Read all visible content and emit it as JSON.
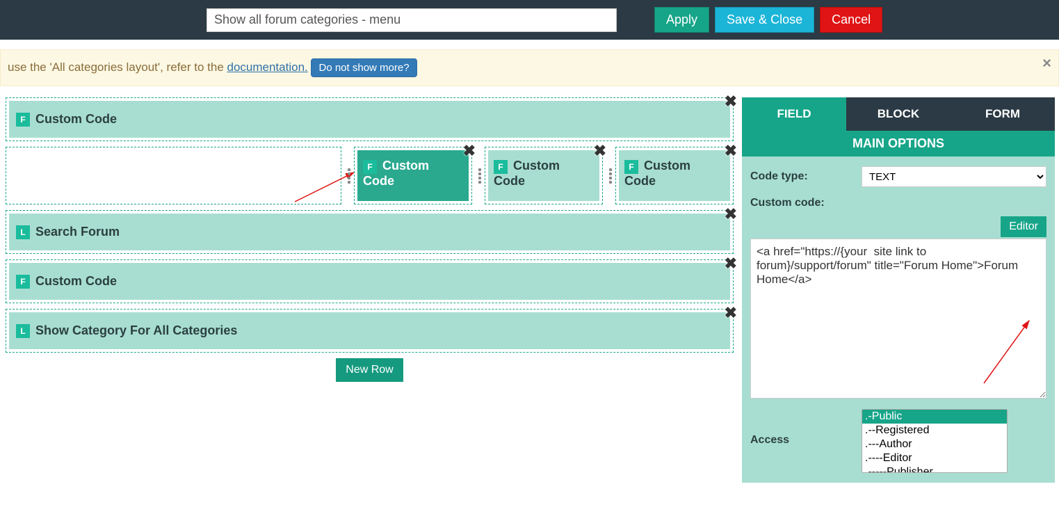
{
  "topbar": {
    "title_value": "Show all forum categories - menu",
    "apply": "Apply",
    "save_close": "Save & Close",
    "cancel": "Cancel"
  },
  "notice": {
    "text_prefix": "use the 'All categories layout', refer to the ",
    "doc_link": "documentation.",
    "btn": "Do not show more?"
  },
  "rows": {
    "r1_label": "Custom Code",
    "r2_cells": [
      "Custom Code",
      "Custom Code",
      "Custom Code"
    ],
    "r3_label": "Search Forum",
    "r4_label": "Custom Code",
    "r5_label": "Show Category For All Categories",
    "new_row": "New Row"
  },
  "panel": {
    "tabs": [
      "FIELD",
      "BLOCK",
      "FORM"
    ],
    "header": "MAIN OPTIONS",
    "code_type_label": "Code type:",
    "code_type_value": "TEXT",
    "custom_code_label": "Custom code:",
    "editor_btn": "Editor",
    "code_value": "<a href=\"https://{your  site link to forum}/support/forum\" title=\"Forum Home\">Forum Home</a>",
    "access_label": "Access",
    "access_options": [
      ".-Public",
      ".--Registered",
      ".---Author",
      ".----Editor",
      ".-----Publisher"
    ]
  }
}
